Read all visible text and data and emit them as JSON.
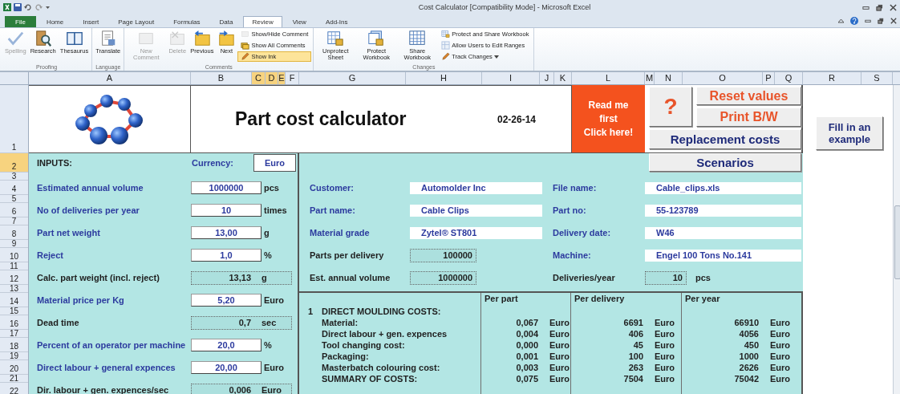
{
  "window": {
    "title": "Cost Calculator [Compatibility Mode] - Microsoft Excel"
  },
  "ribbon_tabs": [
    {
      "label": "File",
      "kind": "file",
      "selected": false
    },
    {
      "label": "Home",
      "kind": "tab",
      "selected": false
    },
    {
      "label": "Insert",
      "kind": "tab",
      "selected": false
    },
    {
      "label": "Page Layout",
      "kind": "tab",
      "selected": false
    },
    {
      "label": "Formulas",
      "kind": "tab",
      "selected": false
    },
    {
      "label": "Data",
      "kind": "tab",
      "selected": false
    },
    {
      "label": "Review",
      "kind": "tab",
      "selected": true
    },
    {
      "label": "View",
      "kind": "tab",
      "selected": false
    },
    {
      "label": "Add-Ins",
      "kind": "tab",
      "selected": false
    }
  ],
  "ribbon_groups": [
    {
      "label": "Proofing",
      "items": [
        {
          "kind": "large",
          "label": "Spelling",
          "disabled": true
        },
        {
          "kind": "large",
          "label": "Research",
          "disabled": false
        },
        {
          "kind": "large",
          "label": "Thesaurus",
          "disabled": false
        }
      ]
    },
    {
      "label": "Language",
      "items": [
        {
          "kind": "large",
          "label": "Translate",
          "disabled": false
        }
      ]
    },
    {
      "label": "Comments",
      "items": [
        {
          "kind": "large",
          "label": "New Comment",
          "disabled": true
        },
        {
          "kind": "large",
          "label": "Delete",
          "disabled": true
        },
        {
          "kind": "large",
          "label": "Previous",
          "disabled": false
        },
        {
          "kind": "large",
          "label": "Next",
          "disabled": false
        },
        {
          "kind": "stack",
          "items": [
            {
              "label": "Show/Hide Comment",
              "disabled": true,
              "on": false,
              "dropdown": false
            },
            {
              "label": "Show All Comments",
              "disabled": false,
              "on": false,
              "dropdown": false
            },
            {
              "label": "Show Ink",
              "disabled": false,
              "on": true,
              "dropdown": false
            }
          ]
        }
      ]
    },
    {
      "label": "Changes",
      "items": [
        {
          "kind": "large",
          "label": "Unprotect Sheet",
          "disabled": false
        },
        {
          "kind": "large",
          "label": "Protect Workbook",
          "disabled": false
        },
        {
          "kind": "large",
          "label": "Share Workbook",
          "disabled": false
        },
        {
          "kind": "stack",
          "items": [
            {
              "label": "Protect and Share Workbook",
              "disabled": false,
              "on": false,
              "dropdown": false
            },
            {
              "label": "Allow Users to Edit Ranges",
              "disabled": true,
              "on": false,
              "dropdown": false
            },
            {
              "label": "Track Changes",
              "disabled": false,
              "on": false,
              "dropdown": true
            }
          ]
        }
      ]
    }
  ],
  "column_headers": [
    {
      "label": "A",
      "selected": false
    },
    {
      "label": "B",
      "selected": false
    },
    {
      "label": "C",
      "selected": true
    },
    {
      "label": "D",
      "selected": true
    },
    {
      "label": "E",
      "selected": true
    },
    {
      "label": "F",
      "selected": false
    },
    {
      "label": "G",
      "selected": false
    },
    {
      "label": "H",
      "selected": false
    },
    {
      "label": "I",
      "selected": false
    },
    {
      "label": "J",
      "selected": false
    },
    {
      "label": "K",
      "selected": false
    },
    {
      "label": "L",
      "selected": false
    },
    {
      "label": "M",
      "selected": false
    },
    {
      "label": "N",
      "selected": false
    },
    {
      "label": "O",
      "selected": false
    },
    {
      "label": "P",
      "selected": false
    },
    {
      "label": "Q",
      "selected": false
    },
    {
      "label": "R",
      "selected": false
    },
    {
      "label": "S",
      "selected": false
    }
  ],
  "row_headers": [
    {
      "label": "1",
      "selected": false
    },
    {
      "label": "2",
      "selected": true
    },
    {
      "label": "3",
      "selected": false
    },
    {
      "label": "4",
      "selected": false
    },
    {
      "label": "5",
      "selected": false
    },
    {
      "label": "6",
      "selected": false
    },
    {
      "label": "7",
      "selected": false
    },
    {
      "label": "8",
      "selected": false
    },
    {
      "label": "9",
      "selected": false
    },
    {
      "label": "10",
      "selected": false
    },
    {
      "label": "11",
      "selected": false
    },
    {
      "label": "12",
      "selected": false
    },
    {
      "label": "13",
      "selected": false
    },
    {
      "label": "14",
      "selected": false
    },
    {
      "label": "15",
      "selected": false
    },
    {
      "label": "16",
      "selected": false
    },
    {
      "label": "17",
      "selected": false
    },
    {
      "label": "18",
      "selected": false
    },
    {
      "label": "19",
      "selected": false
    },
    {
      "label": "20",
      "selected": false
    },
    {
      "label": "21",
      "selected": false
    },
    {
      "label": "22",
      "selected": false
    }
  ],
  "header": {
    "title": "Part cost calculator",
    "date": "02-26-14",
    "read_me_lines": [
      "Read me",
      "first",
      "Click here!"
    ],
    "help": "?",
    "reset": "Reset values",
    "print": "Print B/W",
    "replacement": "Replacement costs",
    "scenarios": "Scenarios",
    "fill_example": "Fill in an example"
  },
  "inputs": {
    "title": "INPUTS:",
    "currency_label": "Currency:",
    "currency": "Euro",
    "rows": [
      {
        "kind": "input",
        "label": "Estimated annual volume",
        "value": "1000000",
        "unit": "pcs"
      },
      {
        "kind": "input",
        "label": "No of deliveries per year",
        "value": "10",
        "unit": "times"
      },
      {
        "kind": "input",
        "label": "Part net weight",
        "value": "13,00",
        "unit": "g"
      },
      {
        "kind": "input",
        "label": "Reject",
        "value": "1,0",
        "unit": "%"
      },
      {
        "kind": "calculated",
        "label": "Calc. part weight (incl. reject)",
        "value": "13,13",
        "unit": "g"
      },
      {
        "kind": "input",
        "label": "Material price per Kg",
        "value": "5,20",
        "unit": "Euro"
      },
      {
        "kind": "calculated",
        "label": "Dead time",
        "value": "0,7",
        "unit": "sec"
      },
      {
        "kind": "input",
        "label": "Percent of an operator per machine",
        "value": "20,0",
        "unit": "%"
      },
      {
        "kind": "input",
        "label": "Direct labour + general expences",
        "value": "20,00",
        "unit": "Euro"
      },
      {
        "kind": "calculated",
        "label": "Dir. labour + gen. expences/sec",
        "value": "0,006",
        "unit": "Euro"
      }
    ]
  },
  "details": {
    "rows": [
      {
        "left": {
          "kind": "text",
          "label": "Customer:",
          "value": "Automolder Inc"
        },
        "right": {
          "kind": "text",
          "label": "File name:",
          "value": "Cable_clips.xls"
        }
      },
      {
        "left": {
          "kind": "text",
          "label": "Part name:",
          "value": "Cable Clips"
        },
        "right": {
          "kind": "text",
          "label": "Part no:",
          "value": "55-123789"
        }
      },
      {
        "left": {
          "kind": "text",
          "label": "Material grade",
          "value": "Zytel® ST801"
        },
        "right": {
          "kind": "text",
          "label": "Delivery date:",
          "value": "W46"
        }
      },
      {
        "left": {
          "kind": "calculated",
          "label": "Parts per delivery",
          "value": "100000"
        },
        "right": {
          "kind": "text",
          "label": "Machine:",
          "value": "Engel 100 Tons No.141"
        }
      },
      {
        "left": {
          "kind": "calculated",
          "label": "Est. annual volume",
          "value": "1000000"
        },
        "right": {
          "kind": "calculated",
          "label": "Deliveries/year",
          "value": "10",
          "unit": "pcs"
        }
      }
    ]
  },
  "costs": {
    "columns": [
      "Per part",
      "Per delivery",
      "Per year"
    ],
    "section": {
      "number": "1",
      "title": "DIRECT MOULDING COSTS:"
    },
    "rows": [
      {
        "label": "Material:",
        "values": [
          {
            "value": "0,067",
            "unit": "Euro"
          },
          {
            "value": "6691",
            "unit": "Euro"
          },
          {
            "value": "66910",
            "unit": "Euro"
          }
        ]
      },
      {
        "label": "Direct labour + gen. expences",
        "values": [
          {
            "value": "0,004",
            "unit": "Euro"
          },
          {
            "value": "406",
            "unit": "Euro"
          },
          {
            "value": "4056",
            "unit": "Euro"
          }
        ]
      },
      {
        "label": "Tool changing cost:",
        "values": [
          {
            "value": "0,000",
            "unit": "Euro"
          },
          {
            "value": "45",
            "unit": "Euro"
          },
          {
            "value": "450",
            "unit": "Euro"
          }
        ]
      },
      {
        "label": "Packaging:",
        "values": [
          {
            "value": "0,001",
            "unit": "Euro"
          },
          {
            "value": "100",
            "unit": "Euro"
          },
          {
            "value": "1000",
            "unit": "Euro"
          }
        ]
      },
      {
        "label": "Masterbatch colouring cost:",
        "values": [
          {
            "value": "0,003",
            "unit": "Euro"
          },
          {
            "value": "263",
            "unit": "Euro"
          },
          {
            "value": "2626",
            "unit": "Euro"
          }
        ]
      },
      {
        "label": "SUMMARY OF COSTS:",
        "values": [
          {
            "value": "0,075",
            "unit": "Euro"
          },
          {
            "value": "7504",
            "unit": "Euro"
          },
          {
            "value": "75042",
            "unit": "Euro"
          }
        ]
      }
    ]
  }
}
